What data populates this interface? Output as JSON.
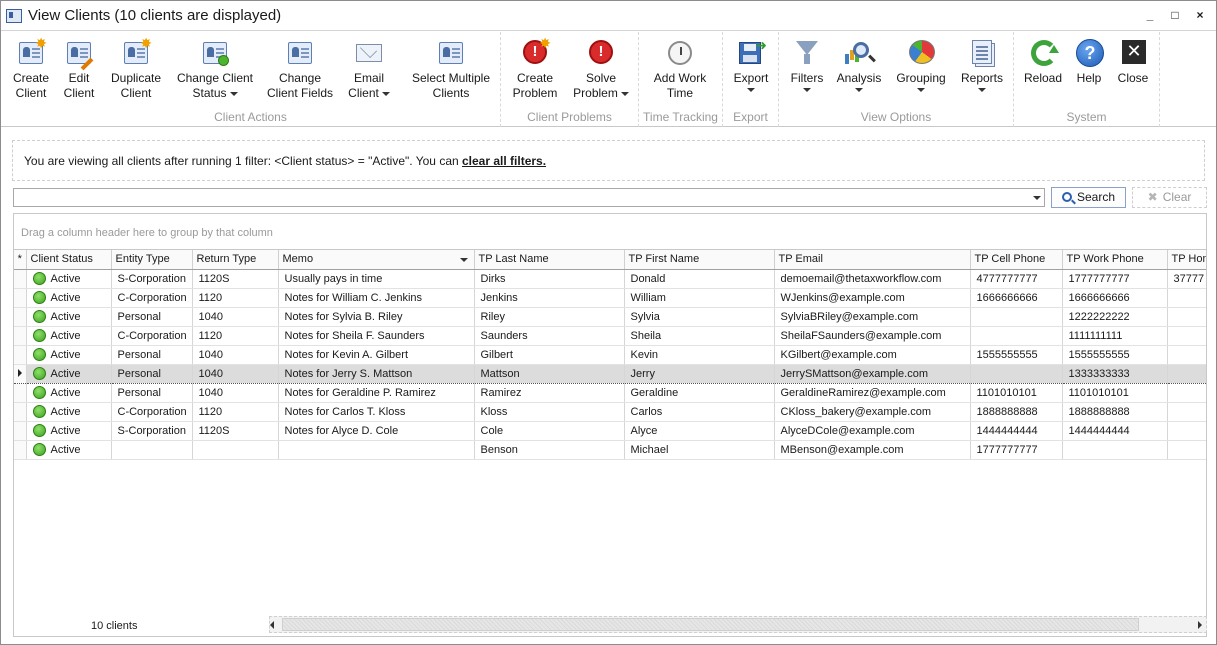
{
  "window": {
    "title": "View Clients (10 clients are displayed)",
    "controls": [
      "_",
      "□",
      "×"
    ]
  },
  "ribbon": {
    "groups": [
      {
        "label": "Client Actions"
      },
      {
        "label": "Client Problems"
      },
      {
        "label": "Time Tracking"
      },
      {
        "label": "Export"
      },
      {
        "label": "View Options"
      },
      {
        "label": "System"
      }
    ],
    "buttons": {
      "create_client": {
        "line1": "Create",
        "line2": "Client",
        "icon": "create-client-icon"
      },
      "edit_client": {
        "line1": "Edit",
        "line2": "Client",
        "icon": "edit-client-icon"
      },
      "duplicate_client": {
        "line1": "Duplicate",
        "line2": "Client",
        "icon": "duplicate-client-icon"
      },
      "change_client_status": {
        "line1": "Change Client",
        "line2": "Status",
        "icon": "change-status-icon"
      },
      "change_client_fields": {
        "line1": "Change",
        "line2": "Client Fields",
        "icon": "change-fields-icon"
      },
      "email_client": {
        "line1": "Email",
        "line2": "Client",
        "icon": "email-icon"
      },
      "select_multiple": {
        "line1": "Select Multiple",
        "line2": "Clients",
        "icon": "select-multiple-icon"
      },
      "create_problem": {
        "line1": "Create",
        "line2": "Problem",
        "icon": "create-problem-icon"
      },
      "solve_problem": {
        "line1": "Solve",
        "line2": "Problem",
        "icon": "solve-problem-icon"
      },
      "add_work_time": {
        "line1": "Add Work",
        "line2": "Time",
        "icon": "stopwatch-icon"
      },
      "export": {
        "line1": "Export",
        "icon": "save-export-icon"
      },
      "filters": {
        "line1": "Filters",
        "icon": "funnel-icon"
      },
      "analysis": {
        "line1": "Analysis",
        "icon": "analysis-icon"
      },
      "grouping": {
        "line1": "Grouping",
        "icon": "pie-chart-icon"
      },
      "reports": {
        "line1": "Reports",
        "icon": "reports-icon"
      },
      "reload": {
        "line1": "Reload",
        "icon": "reload-icon"
      },
      "help": {
        "line1": "Help",
        "icon": "help-icon"
      },
      "close": {
        "line1": "Close",
        "icon": "close-icon"
      }
    }
  },
  "filter_bar": {
    "text": "You are viewing all clients after running 1 filter: <Client status> = \"Active\". You can ",
    "link": "clear all filters."
  },
  "search": {
    "value": "",
    "search_label": "Search",
    "clear_label": "Clear"
  },
  "grid": {
    "group_hint": "Drag a column header here to group by that column",
    "new_row_marker": "*",
    "columns": [
      "Client Status",
      "Entity Type",
      "Return Type",
      "Memo",
      "TP Last Name",
      "TP First Name",
      "TP Email",
      "TP Cell Phone",
      "TP Work Phone",
      "TP Hom"
    ],
    "rows": [
      [
        "Active",
        "S-Corporation",
        "1120S",
        "Usually pays in time",
        "Dirks",
        "Donald",
        "demoemail@thetaxworkflow.com",
        "4777777777",
        "1777777777",
        "37777"
      ],
      [
        "Active",
        "C-Corporation",
        "1120",
        "Notes for William C. Jenkins",
        "Jenkins",
        "William",
        "WJenkins@example.com",
        "1666666666",
        "1666666666",
        ""
      ],
      [
        "Active",
        "Personal",
        "1040",
        "Notes for Sylvia B. Riley",
        "Riley",
        "Sylvia",
        "SylviaBRiley@example.com",
        "",
        "1222222222",
        ""
      ],
      [
        "Active",
        "C-Corporation",
        "1120",
        "Notes for Sheila F. Saunders",
        "Saunders",
        "Sheila",
        "SheilaFSaunders@example.com",
        "",
        "1111111111",
        ""
      ],
      [
        "Active",
        "Personal",
        "1040",
        "Notes for Kevin A. Gilbert",
        "Gilbert",
        "Kevin",
        "KGilbert@example.com",
        "1555555555",
        "1555555555",
        ""
      ],
      [
        "Active",
        "Personal",
        "1040",
        "Notes for Jerry S. Mattson",
        "Mattson",
        "Jerry",
        "JerrySMattson@example.com",
        "",
        "1333333333",
        ""
      ],
      [
        "Active",
        "Personal",
        "1040",
        "Notes for Geraldine P. Ramirez",
        "Ramirez",
        "Geraldine",
        "GeraldineRamirez@example.com",
        "1101010101",
        "1101010101",
        ""
      ],
      [
        "Active",
        "C-Corporation",
        "1120",
        "Notes for Carlos T. Kloss",
        "Kloss",
        "Carlos",
        "CKloss_bakery@example.com",
        "1888888888",
        "1888888888",
        ""
      ],
      [
        "Active",
        "S-Corporation",
        "1120S",
        "Notes for Alyce D. Cole",
        "Cole",
        "Alyce",
        "AlyceDCole@example.com",
        "1444444444",
        "1444444444",
        ""
      ],
      [
        "Active",
        "",
        "",
        "",
        "Benson",
        "Michael",
        "MBenson@example.com",
        "1777777777",
        "",
        ""
      ]
    ],
    "selected_row": 5,
    "status_color": "#3ca31e"
  },
  "footer": {
    "count": "10 clients"
  }
}
